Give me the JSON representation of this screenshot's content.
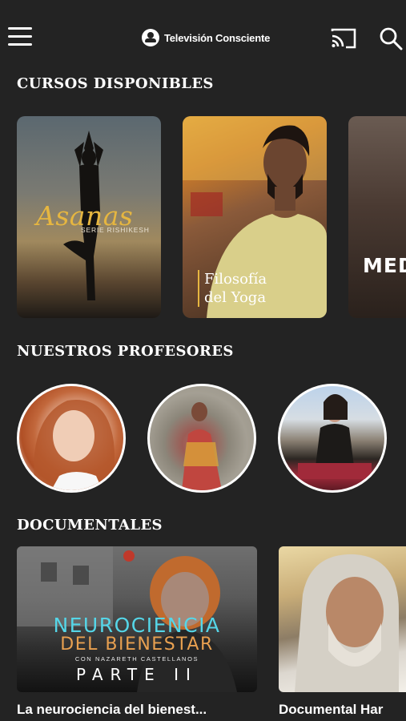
{
  "header": {
    "brand": "Televisión Consciente",
    "icons": {
      "menu": "menu-icon",
      "cast": "cast-icon",
      "search": "search-icon"
    }
  },
  "sections": {
    "courses_title": "CURSOS DISPONIBLES",
    "professors_title": "NUESTROS PROFESORES",
    "documentaries_title": "DOCUMENTALES"
  },
  "courses": [
    {
      "title": "Asanas",
      "subtitle": "SERIE RISHIKESH"
    },
    {
      "title_line1": "Filosofía",
      "title_line2": "del Yoga"
    },
    {
      "title": "MEDI"
    }
  ],
  "documentaries": [
    {
      "poster_line1": "NEUROCIENCIA",
      "poster_line2": "DEL BIENESTAR",
      "poster_line3": "CON NAZARETH CASTELLANOS",
      "poster_line4": "PARTE II",
      "title": "La neurociencia del bienest..."
    },
    {
      "title": "Documental Har"
    }
  ],
  "colors": {
    "background": "#232323",
    "accent_gold": "#e6b640",
    "accent_cyan": "#55d6e8",
    "accent_orange": "#e8a050"
  }
}
